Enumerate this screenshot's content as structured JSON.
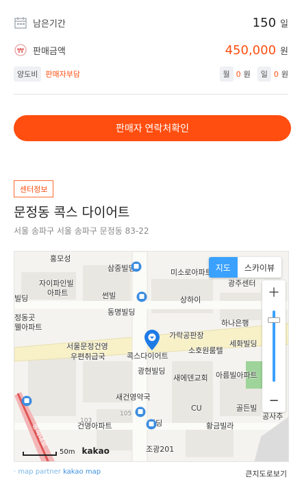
{
  "summary": {
    "period_label": "남은기간",
    "period_value": "150",
    "period_unit": "일",
    "amount_label": "판매금액",
    "amount_value": "450,000",
    "amount_unit": "원",
    "transfer_chip": "양도비",
    "transfer_note": "판매자부담",
    "monthly_label": "월",
    "monthly_value": "0",
    "monthly_unit": "원",
    "daily_label": "일",
    "daily_value": "0",
    "daily_unit": "원"
  },
  "cta": {
    "label": "판매자 연락처확인"
  },
  "center": {
    "tag": "센터정보",
    "name": "문정동 콕스 다이어트",
    "address": "서울 송파구 서울 송파구 문정동 83-22"
  },
  "map": {
    "toggle_map": "지도",
    "toggle_sky": "스카이뷰",
    "scale_label": "50m",
    "brand": "kakao",
    "labels": {
      "l1": "홍모성",
      "l2": "삼중빌딩",
      "l3": "미소로아파트",
      "l4": "자이파인빌",
      "l5": "아파트",
      "l6": "썬빌",
      "l7": "빌딩",
      "l8": "상하이",
      "l9": "동명빌딩",
      "l10": "정동곳",
      "l11": "웰아파트",
      "l12": "하나은행",
      "l13": "가락공판장",
      "l14": "서울문정건영",
      "l15": "우편취급국",
      "l16": "세화빌딩",
      "l17": "콕스다이어트",
      "l18": "소호원룸텔",
      "l19": "광현빌딩",
      "l20": "새에덴교회",
      "l21": "아름빌아파트",
      "l22": "새건영약국",
      "l23": "CU",
      "l24": "골든빌",
      "l25": "공사추",
      "l26": "건영아파트",
      "l27": "황금빌라",
      "l28": "조광201",
      "l29": "105",
      "l30": "103",
      "l31": "송파대로",
      "l32": "광주센터",
      "l33": "빌딩"
    },
    "colors": {
      "road": "#f8f1c8",
      "block": "#e8e6e0",
      "park": "#9ed49a",
      "accent": "#3aa1ff",
      "pin": "#1e7be6"
    }
  },
  "footer": {
    "partner_prefix": "· map partner",
    "partner_brand": "kakao map",
    "bigmap_label": "큰지도로보기"
  }
}
